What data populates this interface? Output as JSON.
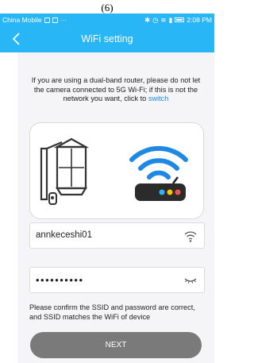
{
  "caption": "(6)",
  "status_bar": {
    "carrier": "China Mobile",
    "time": "2:08 PM"
  },
  "header": {
    "title": "WiFi setting",
    "back_icon": "chevron-left-icon"
  },
  "instructions": {
    "text": "If you are using a dual-band router, please do not let the camera connected to 5G Wi-Fi; if this is not the network you want, click to ",
    "switch_link": "switch"
  },
  "illustration": {
    "camera_icon": "wall-lantern-camera",
    "wifi_icon": "wifi-icon",
    "router_icon": "router-icon",
    "accent_color": "#1e88e5"
  },
  "ssid_field": {
    "value": "annkeceshi01",
    "icon": "wifi-icon"
  },
  "password_field": {
    "value": "••••••••••",
    "icon": "eye-closed-icon"
  },
  "confirm_text": "Please confirm the SSID and password are correct, and SSID matches the WiFi of device",
  "next_button": {
    "label": "NEXT",
    "color": "#7a7a7a"
  },
  "colors": {
    "header": "#29b6f6",
    "background": "#f5f5f7"
  }
}
